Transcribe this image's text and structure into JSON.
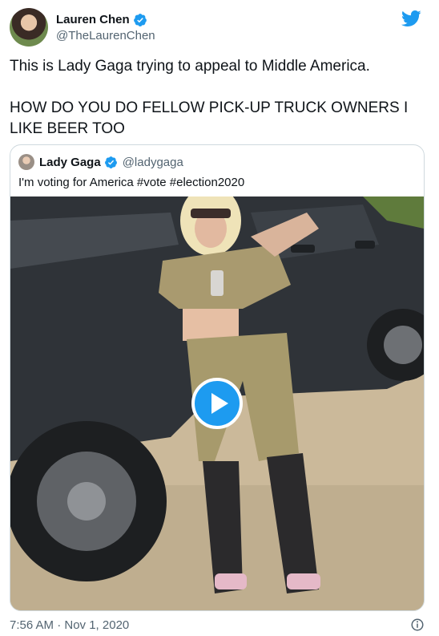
{
  "author": {
    "display_name": "Lauren Chen",
    "handle": "@TheLaurenChen"
  },
  "tweet": {
    "text": "This is Lady Gaga trying to appeal to Middle America.\n\nHOW DO YOU DO FELLOW PICK-UP TRUCK OWNERS I LIKE BEER TOO"
  },
  "quoted_tweet": {
    "display_name": "Lady Gaga",
    "handle": "@ladygaga",
    "text": "I'm voting for America #vote #election2020"
  },
  "media": {
    "type": "video",
    "play_icon": "play-icon"
  },
  "footer": {
    "timestamp": "7:56 AM · Nov 1, 2020",
    "info_icon": "info-icon"
  },
  "colors": {
    "accent": "#1d9bf0",
    "text_primary": "#0f1419",
    "text_secondary": "#536471",
    "border": "#cfd9de"
  }
}
